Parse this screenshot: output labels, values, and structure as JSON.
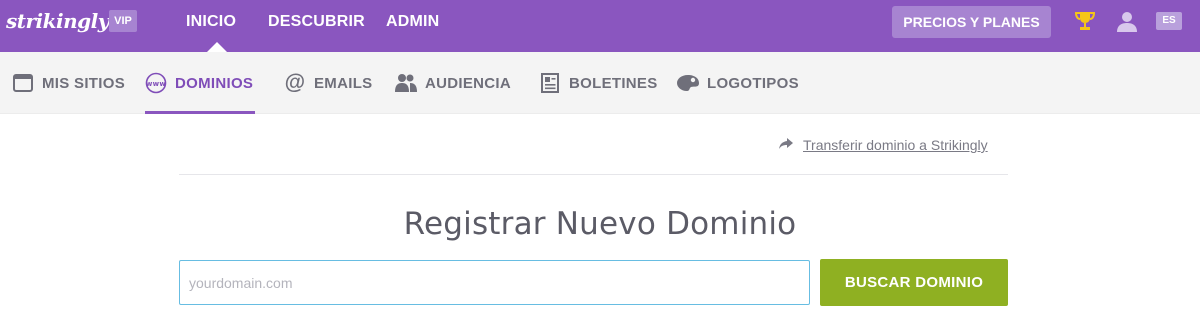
{
  "header": {
    "logo": "strikingly",
    "badge": "VIP",
    "nav": [
      {
        "label": "INICIO",
        "active": true
      },
      {
        "label": "DESCUBRIR",
        "active": false
      },
      {
        "label": "ADMIN",
        "active": false
      }
    ],
    "pricing_label": "PRECIOS Y PLANES",
    "language": "ES",
    "brand_color": "#8a56bf"
  },
  "subnav": {
    "items": [
      {
        "label": "MIS SITIOS",
        "icon": "browser-window-icon",
        "active": false
      },
      {
        "label": "DOMINIOS",
        "icon": "www-icon",
        "active": true
      },
      {
        "label": "EMAILS",
        "icon": "at-icon",
        "active": false
      },
      {
        "label": "AUDIENCIA",
        "icon": "people-icon",
        "active": false
      },
      {
        "label": "BOLETINES",
        "icon": "newsletter-icon",
        "active": false
      },
      {
        "label": "LOGOTIPOS",
        "icon": "palette-icon",
        "active": false
      }
    ]
  },
  "main": {
    "transfer_link": "Transferir dominio a Strikingly",
    "title": "Registrar Nuevo Dominio",
    "search": {
      "placeholder": "yourdomain.com",
      "value": ""
    },
    "search_button": "BUSCAR DOMINIO",
    "button_color": "#8fb022"
  }
}
